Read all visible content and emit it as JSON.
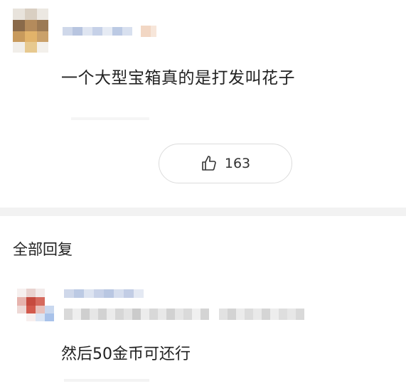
{
  "post": {
    "content": "一个大型宝箱真的是打发叫花子",
    "like_count": "163"
  },
  "replies_section": {
    "title": "全部回复"
  },
  "reply": {
    "content": "然后50金币可还行"
  },
  "colors": {
    "divider": "#f2f2f2",
    "border": "#dcdcdc",
    "text": "#222222"
  }
}
